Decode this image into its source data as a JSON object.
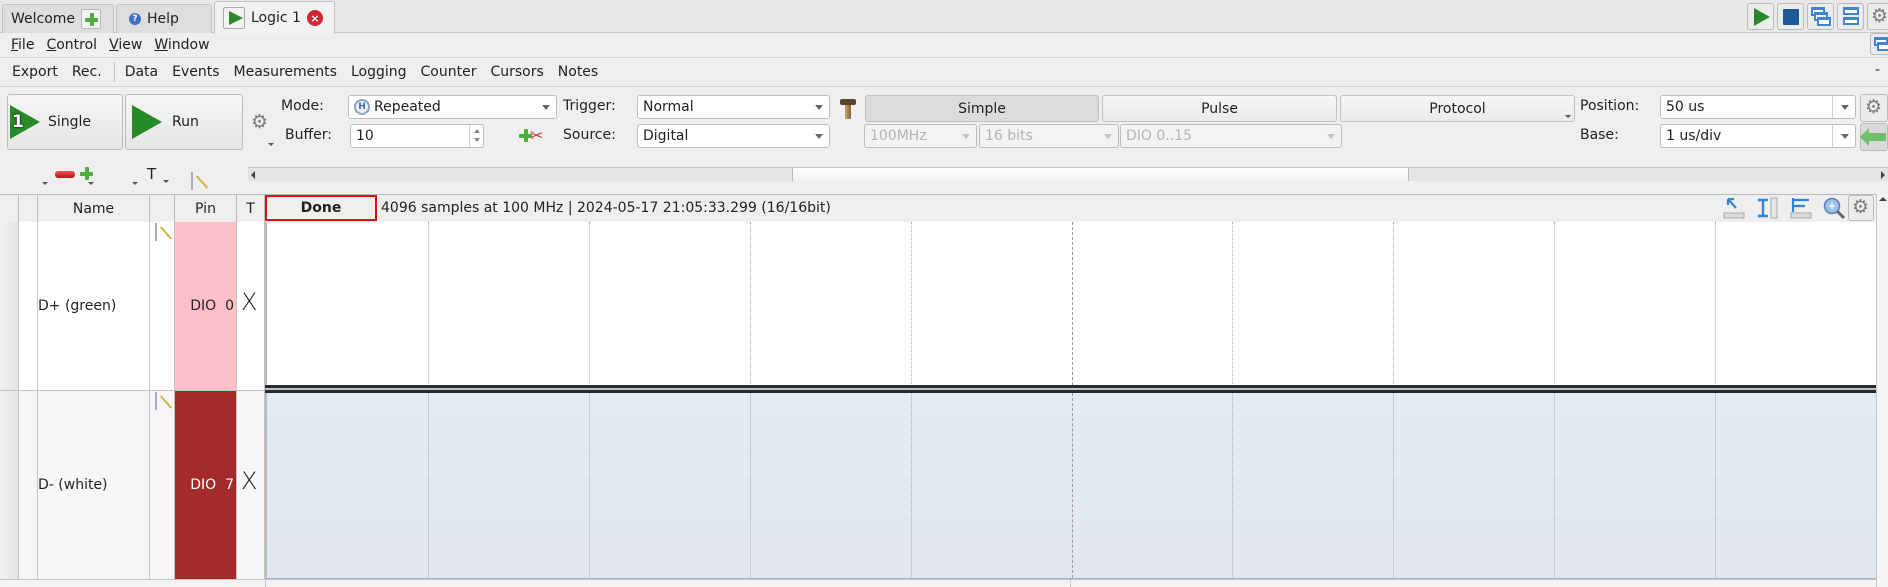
{
  "tabs": [
    {
      "label": "Welcome",
      "icon": "add-icon"
    },
    {
      "label": "Help",
      "icon": "help-icon"
    },
    {
      "label": "Logic 1",
      "icon": "play-icon",
      "active": true,
      "close_icon": "close-icon"
    }
  ],
  "window_toolbar": [
    {
      "name": "run",
      "icon": "play-icon"
    },
    {
      "name": "stop",
      "icon": "stop-icon"
    },
    {
      "name": "cascade",
      "icon": "cascade-windows-icon"
    },
    {
      "name": "tile",
      "icon": "tile-windows-icon"
    },
    {
      "name": "settings",
      "icon": "gear-icon"
    }
  ],
  "menubar": [
    {
      "label": "File",
      "mnemonic": "F",
      "rest": "ile"
    },
    {
      "label": "Control",
      "mnemonic": "C",
      "rest": "ontrol"
    },
    {
      "label": "View",
      "mnemonic": "V",
      "rest": "iew"
    },
    {
      "label": "Window",
      "mnemonic": "W",
      "rest": "indow"
    }
  ],
  "subbar": {
    "group1": [
      "Export",
      "Rec."
    ],
    "group2": [
      "Data",
      "Events",
      "Measurements",
      "Logging",
      "Counter",
      "Cursors",
      "Notes"
    ],
    "collapse": "-"
  },
  "controls": {
    "single_label": "Single",
    "single_badge": "1",
    "run_label": "Run",
    "mode_label": "Mode:",
    "mode_value": "Repeated",
    "mode_icon_text": "H",
    "buffer_label": "Buffer:",
    "buffer_value": "10",
    "trigger_label": "Trigger:",
    "trigger_value": "Normal",
    "source_label": "Source:",
    "source_value": "Digital",
    "rate_value": "100MHz",
    "bits_value": "16 bits",
    "channels_value": "DIO 0..15",
    "trigger_tabs": [
      "Simple",
      "Pulse",
      "Protocol"
    ],
    "active_trigger_tab": "Simple",
    "position_label": "Position:",
    "position_value": "50 us",
    "base_label": "Base:",
    "base_value": "1 us/div"
  },
  "channel_toolbar": {
    "add": "add-channel-icon",
    "remove": "remove-channel-icon",
    "note": "note-icon",
    "text": "T"
  },
  "table": {
    "headers": {
      "name": "Name",
      "pin": "Pin",
      "trigger": "T"
    },
    "status_button": "Done",
    "status_text": "4096 samples at 100 MHz | 2024-05-17 21:05:33.299 (16/16bit)",
    "rows": [
      {
        "name": "D+ (green)",
        "pin": "DIO  0",
        "trigger": "X",
        "pin_color": "#ffc0cb",
        "pin_text_color": "#222222"
      },
      {
        "name": "D- (white)",
        "pin": "DIO  7",
        "trigger": "X",
        "pin_color": "#a52a2a",
        "pin_text_color": "#ffffff"
      }
    ]
  },
  "plot_tools": [
    "cursor-select-icon",
    "ruler-measure-icon",
    "ruler-level-icon",
    "zoom-icon",
    "gear-icon"
  ],
  "plot": {
    "divisions": 10,
    "grid_color": "#b0b0b0",
    "selected_row_bg": "#e1ecf5"
  },
  "scroll": {
    "horizontal_position": 0.33,
    "horizontal_visible": 0.38
  }
}
